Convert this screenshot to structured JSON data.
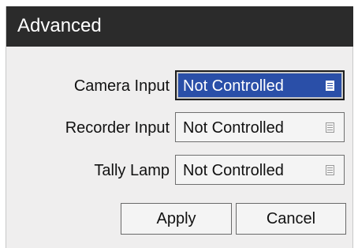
{
  "dialog": {
    "title": "Advanced"
  },
  "fields": [
    {
      "label": "Camera Input",
      "value": "Not Controlled",
      "focused": true
    },
    {
      "label": "Recorder Input",
      "value": "Not Controlled",
      "focused": false
    },
    {
      "label": "Tally Lamp",
      "value": "Not Controlled",
      "focused": false
    }
  ],
  "buttons": {
    "apply_label": "Apply",
    "cancel_label": "Cancel"
  },
  "icons": {
    "dropdown": "menu-lines-icon"
  },
  "colors": {
    "titlebar": "#2b2b2b",
    "focused_select": "#2a4fa8",
    "dialog_background": "#efeeee"
  }
}
